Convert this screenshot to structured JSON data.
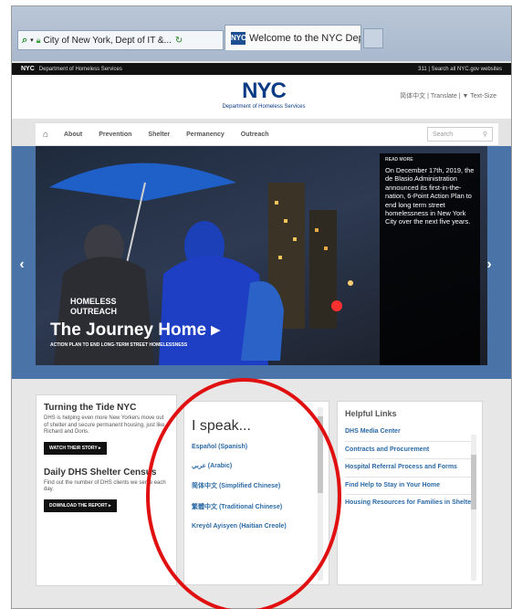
{
  "browser": {
    "address_text": "City of New York, Dept of IT &...",
    "tab_title": "Welcome to the NYC Depar...",
    "tab_favicon": "NYC"
  },
  "top_strip": {
    "brand": "NYC",
    "dept": "Department of Homeless Services",
    "right": "311 | Search all NYC.gov websites"
  },
  "header": {
    "logo": "NYC",
    "dept_name": "Department of Homeless Services",
    "tools": "简体中文 | Translate | ▼   Text-Size"
  },
  "nav": {
    "items": [
      "About",
      "Prevention",
      "Shelter",
      "Permanency",
      "Outreach"
    ],
    "search_placeholder": "Search"
  },
  "hero": {
    "title": "The Journey Home ▸",
    "subtitle": "ACTION PLAN TO END LONG-TERM STREET HOMELESSNESS",
    "sign_text": "HOMELESS OUTREACH",
    "side_label": "READ MORE",
    "side_text": "On December 17th, 2019, the de Blasio Administration announced its first-in-the-nation, 6-Point Action Plan to end long term street homelessness in New York City over the next five years."
  },
  "left_card": {
    "title1": "Turning the Tide NYC",
    "text1": "DHS is helping even more New Yorkers move out of shelter and secure permanent housing, just like Richard and Doris.",
    "btn1": "WATCH THEIR STORY ▸",
    "title2": "Daily DHS Shelter Census",
    "text2": "Find out the number of DHS clients we serve each day.",
    "btn2": "DOWNLOAD THE REPORT ▸"
  },
  "speak": {
    "title": "I speak...",
    "languages": [
      "Español (Spanish)",
      "عربي (Arabic)",
      "简体中文 (Simplified Chinese)",
      "繁體中文 (Traditional Chinese)",
      "Kreyòl Ayisyen (Haitian Creole)"
    ]
  },
  "helpful": {
    "title": "Helpful Links",
    "links": [
      "DHS Media Center",
      "Contracts and Procurement",
      "Hospital Referral Process and Forms",
      "Find Help to Stay in Your Home",
      "Housing Resources for Families in Shelter"
    ]
  },
  "colors": {
    "nyc_blue": "#0b3b85",
    "link_blue": "#2b6aa5",
    "annotation_red": "#e01010"
  }
}
